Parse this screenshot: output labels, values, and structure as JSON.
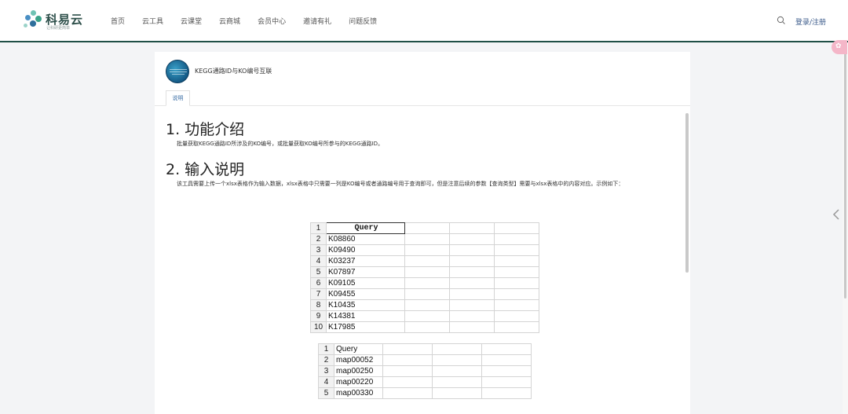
{
  "brand": {
    "name": "科易云",
    "tagline": "让科研更简单"
  },
  "nav": [
    "首页",
    "云工具",
    "云课堂",
    "云商城",
    "会员中心",
    "邀请有礼",
    "问题反馈"
  ],
  "header": {
    "login_label": "登录/注册"
  },
  "tool": {
    "name": "KEGG通路ID与KO编号互联"
  },
  "tabs": [
    "说明"
  ],
  "doc": {
    "section1_title": "1. 功能介绍",
    "section1_text": "批量获取KEGG通路ID所涉及的KO编号，或批量获取KO编号所参与的KEGG通路ID。",
    "section2_title": "2. 输入说明",
    "section2_text": "该工具需要上传一个xlsx表格作为输入数据，xlsx表格中只需要一列是KO编号或者通路编号用于查询即可，但是注意后续的参数【查询类型】需要与xlsx表格中的内容对应。示例如下："
  },
  "sheet1": {
    "rows": [
      {
        "n": "1",
        "v": "Query"
      },
      {
        "n": "2",
        "v": "K08860"
      },
      {
        "n": "3",
        "v": "K09490"
      },
      {
        "n": "4",
        "v": "K03237"
      },
      {
        "n": "5",
        "v": "K07897"
      },
      {
        "n": "6",
        "v": "K09105"
      },
      {
        "n": "7",
        "v": "K09455"
      },
      {
        "n": "8",
        "v": "K10435"
      },
      {
        "n": "9",
        "v": "K14381"
      },
      {
        "n": "10",
        "v": "K17985"
      }
    ]
  },
  "sheet2": {
    "rows": [
      {
        "n": "1",
        "v": "Query"
      },
      {
        "n": "2",
        "v": "map00052"
      },
      {
        "n": "3",
        "v": "map00250"
      },
      {
        "n": "4",
        "v": "map00220"
      },
      {
        "n": "5",
        "v": "map00330"
      }
    ]
  },
  "colors": {
    "accent": "#1f4f46",
    "link": "#3a6ea5",
    "pink": "#f4b6c8"
  },
  "icons": {
    "search": "search-icon",
    "back": "chevron-left-icon"
  }
}
